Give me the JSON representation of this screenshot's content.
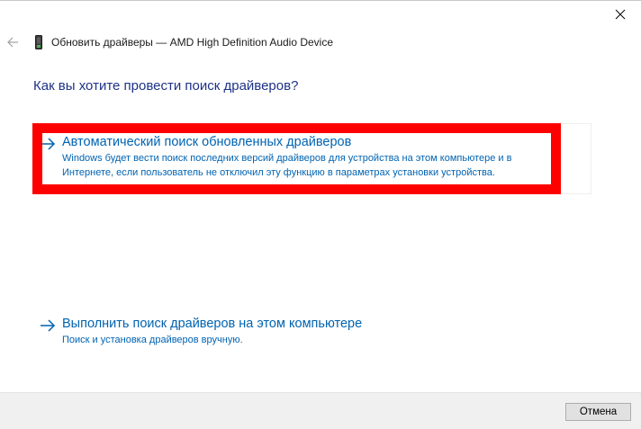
{
  "window": {
    "title": "Обновить драйверы — AMD High Definition Audio Device"
  },
  "icons": {
    "close": "close-icon",
    "back": "back-arrow-icon",
    "device": "audio-device-icon",
    "option_arrow": "arrow-right-icon"
  },
  "colors": {
    "question": "#1e3287",
    "link": "#0063b1",
    "highlight": "#ff0000",
    "footer_bg": "#f0f0f0"
  },
  "main": {
    "question": "Как вы хотите провести поиск драйверов?",
    "options": [
      {
        "title": "Автоматический поиск обновленных драйверов",
        "desc_line1": "Windows будет вести поиск последних версий драйверов для устройства на этом компьютере и в",
        "desc_line2": "Интернете, если пользователь не отключил эту функцию в параметрах установки устройства."
      },
      {
        "title": "Выполнить поиск драйверов на этом компьютере",
        "desc_line1": "Поиск и установка драйверов вручную."
      }
    ]
  },
  "footer": {
    "cancel_label": "Отмена"
  }
}
